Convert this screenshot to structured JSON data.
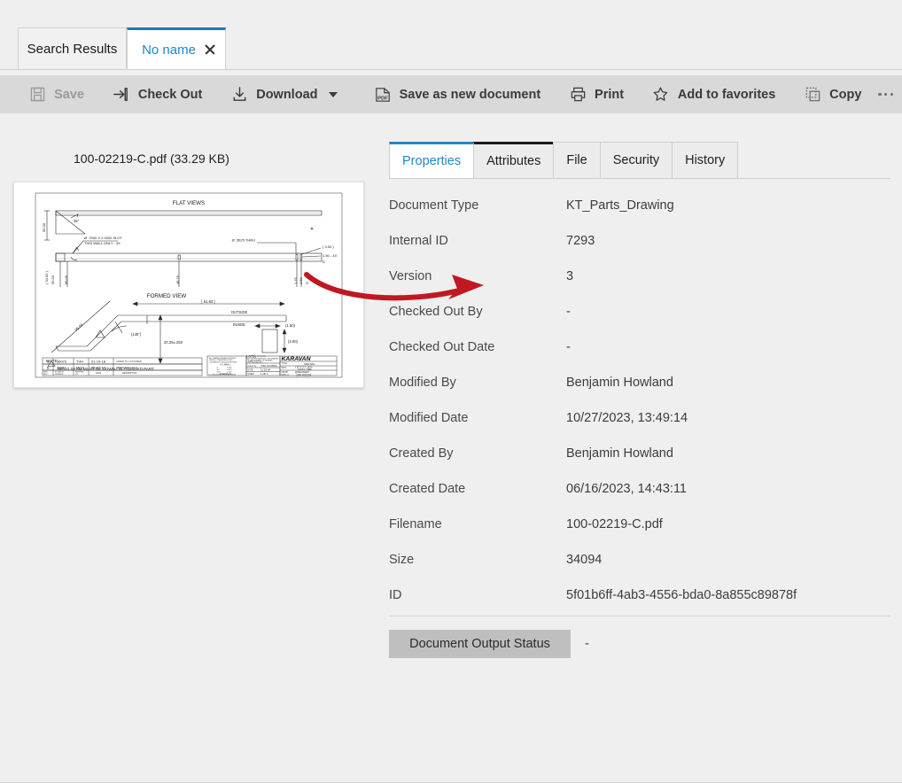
{
  "window": {
    "tabs": [
      {
        "label": "Search Results",
        "active": false,
        "closable": false
      },
      {
        "label": "No name",
        "active": true,
        "closable": true
      }
    ]
  },
  "toolbar": {
    "items": [
      {
        "label": "Save",
        "icon": "save-icon",
        "disabled": true,
        "dropdown": false
      },
      {
        "label": "Check Out",
        "icon": "check-out-icon",
        "disabled": false,
        "dropdown": false
      },
      {
        "label": "Download",
        "icon": "download-icon",
        "disabled": false,
        "dropdown": true
      },
      {
        "label": "Save as new document",
        "icon": "pdf-icon",
        "disabled": false,
        "dropdown": false
      },
      {
        "label": "Print",
        "icon": "printer-icon",
        "disabled": false,
        "dropdown": false
      },
      {
        "label": "Add to favorites",
        "icon": "star-icon",
        "disabled": false,
        "dropdown": false
      },
      {
        "label": "Copy",
        "icon": "copy-icon",
        "disabled": false,
        "dropdown": false
      }
    ],
    "overflow_label": "more-options"
  },
  "preview": {
    "title": "100-02219-C.pdf  (33.29 KB)",
    "drawing": {
      "flat_views_title": "FLAT VIEWS",
      "formed_view_title": "FORMED VIEW",
      "angle_top": "35°",
      "angle_formed": "(145°)",
      "dim_96_00": "96.00",
      "dim_94_00": "(94.00)",
      "dim_95_50": "95.50",
      "dim_88_00": "88.00",
      "dim_48_75": "48.75",
      "dim_61_63": "[61.63]",
      "dim_35_00": "35.00",
      "dim_20_25": "20.25±.250",
      "dim_3_00": "(3.00)",
      "dim_1_50": "(1.50)",
      "dim_1_50_4x": "1.50 - 4X",
      "dim_1_75": "1.75",
      "dim_075": "(.075)",
      "slot_note": "Ø .7500 X 2.0000 SLOT",
      "slot_note2": "THIS WALL ONLY - 3X",
      "hole_note": "Ø .5625 THRU",
      "outside_label": "OUTSIDE",
      "inside_label": "INSIDE",
      "note_label": "NOTE:",
      "note_text": "WELD SEAM MUST BE DOWN ON FINISHED PART",
      "brand": "KARAVAN",
      "title_label": "TITLE:",
      "title_value": "SIDE RAIL",
      "matl_label": "MATL",
      "matl_value": "1.50\" X 3\" X .14GA H.R.P.O. TUBE",
      "finish_label": "FINISH",
      "finish_value": "@WELDMENT",
      "dwg_label": "DWG. #",
      "dwg_value": "100-02219",
      "approved_label": "APPROVED BY:",
      "drawn_label": "DRAWN BY:",
      "drawn_value": "JOEL NUHRING",
      "date_label": "DATE",
      "date_value": "11-18-04",
      "sheet_label": "SHEET",
      "sheet_value": "1 OF 1",
      "scale_label": "SCALE",
      "scale_value": "N/A",
      "angles_label": "ANGLES",
      "angles_value": ".5°",
      "rev_rows": [
        {
          "rev": "C",
          "num": "16070",
          "by": "TVH",
          "date": "01-19-18",
          "desc": "ADDED TO CUSTOMER"
        },
        {
          "rev": "B",
          "num": "38011",
          "by": "MCS",
          "date": "05-01-17",
          "desc": "ADDED SIDE HOLE"
        }
      ],
      "rev_header": [
        "ENG. REV.",
        "ECN/ECR NUMBER",
        "REVISED BY",
        "DATE",
        "DESCRIPTION"
      ]
    }
  },
  "details": {
    "tabs": [
      {
        "label": "Properties",
        "state": "selected"
      },
      {
        "label": "Attributes",
        "state": "focused"
      },
      {
        "label": "File",
        "state": "normal"
      },
      {
        "label": "Security",
        "state": "normal"
      },
      {
        "label": "History",
        "state": "normal"
      }
    ],
    "properties": [
      {
        "label": "Document Type",
        "value": "KT_Parts_Drawing"
      },
      {
        "label": "Internal ID",
        "value": "7293"
      },
      {
        "label": "Version",
        "value": "3"
      },
      {
        "label": "Checked Out By",
        "value": "-"
      },
      {
        "label": "Checked Out Date",
        "value": "-"
      },
      {
        "label": "Modified By",
        "value": "Benjamin Howland"
      },
      {
        "label": "Modified Date",
        "value": "10/27/2023, 13:49:14"
      },
      {
        "label": "Created By",
        "value": "Benjamin Howland"
      },
      {
        "label": "Created Date",
        "value": "06/16/2023, 14:43:11"
      },
      {
        "label": "Filename",
        "value": "100-02219-C.pdf"
      },
      {
        "label": "Size",
        "value": "34094"
      },
      {
        "label": "ID",
        "value": "5f01b6ff-4ab3-4556-bda0-8a855c89878f"
      }
    ],
    "output_status": {
      "label": "Document Output Status",
      "value": "-"
    }
  },
  "annotation": {
    "arrow": "red-curved-arrow",
    "color": "#c01823"
  },
  "colors": {
    "accent": "#2286c4",
    "toolbar_bg": "#d9d9d9",
    "page_bg": "#efefef",
    "annotation_red": "#c01823",
    "button_gray": "#bfbfbf"
  }
}
